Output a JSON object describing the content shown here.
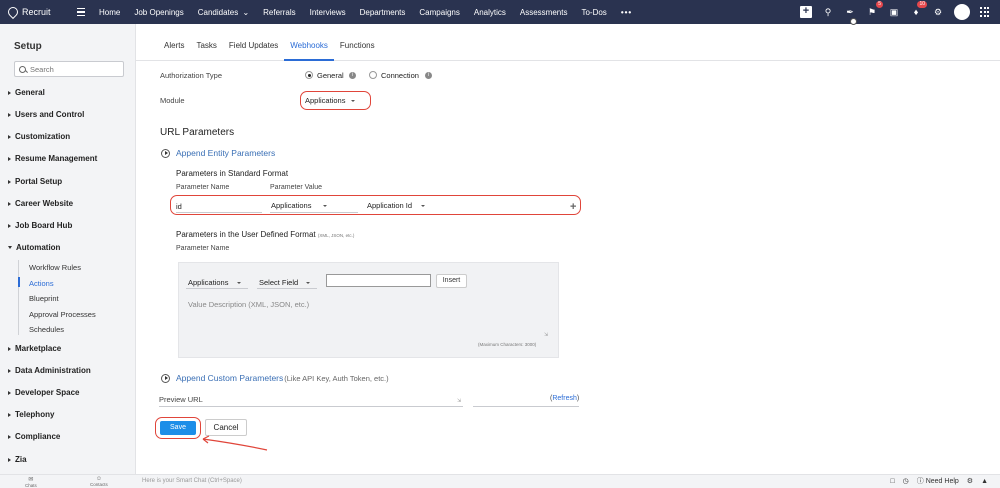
{
  "app": {
    "name": "Recruit"
  },
  "nav": {
    "items": [
      "Home",
      "Job Openings",
      "Candidates",
      "Referrals",
      "Interviews",
      "Departments",
      "Campaigns",
      "Analytics",
      "Assessments",
      "To-Dos"
    ],
    "more_label": "•••",
    "badges": {
      "activity": "5",
      "notifications": "10"
    }
  },
  "sidebar": {
    "title": "Setup",
    "search_placeholder": "Search",
    "groups": [
      "General",
      "Users and Control",
      "Customization",
      "Resume Management",
      "Portal Setup",
      "Career Website",
      "Job Board Hub",
      "Automation",
      "Marketplace",
      "Data Administration",
      "Developer Space",
      "Telephony",
      "Compliance",
      "Zia"
    ],
    "automation_items": [
      "Workflow Rules",
      "Actions",
      "Blueprint",
      "Approval Processes",
      "Schedules"
    ]
  },
  "tabs": [
    "Alerts",
    "Tasks",
    "Field Updates",
    "Webhooks",
    "Functions"
  ],
  "form": {
    "auth_type_label": "Authorization Type",
    "auth_general": "General",
    "auth_connection": "Connection",
    "module_label": "Module",
    "module_value": "Applications",
    "url_params_title": "URL Parameters",
    "append_entity": "Append Entity Parameters",
    "std_format": "Parameters in Standard Format",
    "param_name_label": "Parameter Name",
    "param_value_label": "Parameter Value",
    "param_name_value": "id",
    "param_module": "Applications",
    "param_field": "Application Id",
    "user_defined_format": "Parameters in the User Defined Format",
    "user_defined_hint": "(XML, JSON, etc.)",
    "param_name_label2": "Parameter Name",
    "ud_module": "Applications",
    "ud_field": "Select Field",
    "insert_label": "Insert",
    "value_desc_placeholder": "Value Description (XML, JSON, etc.)",
    "max_chars": "(Maximum Characters: 3000)",
    "append_custom": "Append Custom Parameters",
    "append_custom_hint": "(Like API Key, Auth Token, etc.)",
    "preview_url_label": "Preview URL",
    "refresh_open": "(",
    "refresh_label": "Refresh",
    "refresh_close": ")",
    "save_label": "Save",
    "cancel_label": "Cancel"
  },
  "bottom": {
    "chats": "Chats",
    "contacts": "Contacts",
    "smart_chat": "Here is your Smart Chat (Ctrl+Space)",
    "need_help": "Need Help"
  },
  "colors": {
    "accent": "#2b6cd6",
    "topbar": "#2a3350",
    "highlight": "#e0453a",
    "save": "#1d8ee8"
  }
}
